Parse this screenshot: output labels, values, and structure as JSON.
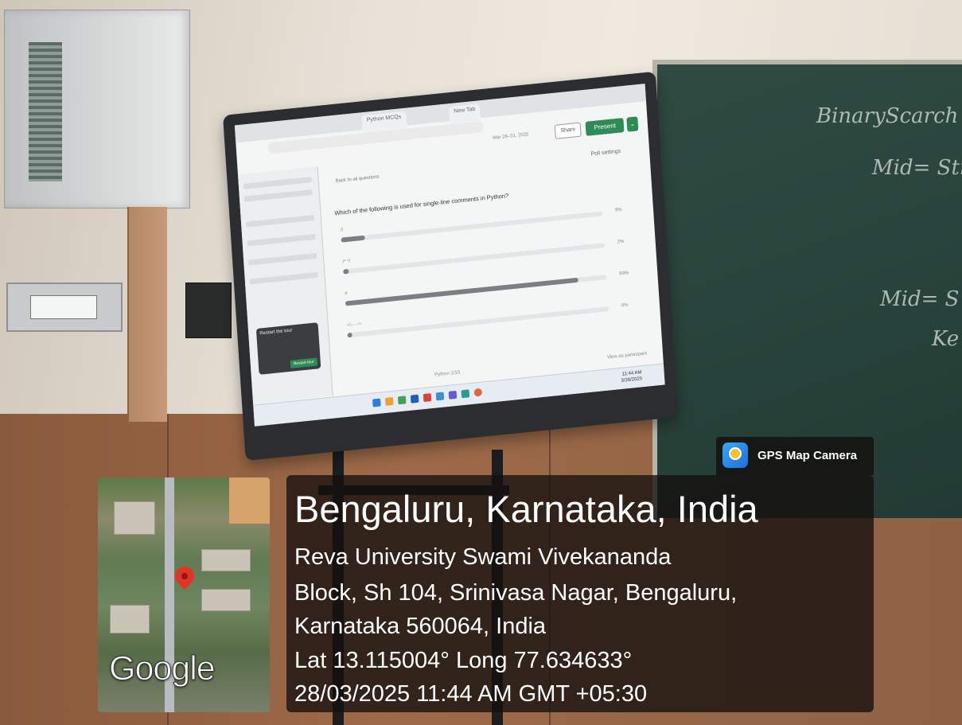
{
  "badge": {
    "label": "GPS Map Camera",
    "icon": "map-pin-camera-icon"
  },
  "location": {
    "title": "Bengaluru, Karnataka, India",
    "address_line1": "Reva University Swami Vivekananda",
    "address_line2": "Block, Sh 104, Srinivasa Nagar, Bengaluru,",
    "address_line3": "Karnataka 560064, India",
    "coordinates": "Lat 13.115004° Long 77.634633°",
    "timestamp": "28/03/2025 11:44 AM GMT +05:30"
  },
  "map": {
    "logo_text": "Google",
    "pin_icon": "location-pin-icon"
  },
  "chalkboard": {
    "line1": "BinaryScarch",
    "line2": "Mid= Stri",
    "line3": "Mid= S",
    "line4": "Ke"
  },
  "screen": {
    "tabs": [
      "Python MCQs",
      "New Tab"
    ],
    "date_range": "Mar 28–31, 2025",
    "share_label": "Share",
    "present_label": "Present",
    "present_more": "⌄",
    "back_label": "Back to all questions",
    "poll_settings_label": "Poll settings",
    "question": "Which of the following is used for single-line comments in Python?",
    "options": [
      {
        "label": "//",
        "percent_value": 9,
        "percent_text": "9%"
      },
      {
        "label": "/* */",
        "percent_value": 2,
        "percent_text": "2%"
      },
      {
        "label": "#",
        "percent_value": 89,
        "percent_text": "89%"
      },
      {
        "label": "<!-- -->",
        "percent_value": 0,
        "percent_text": "0%"
      }
    ],
    "footer_center": "Python 1/10",
    "footer_right": "View as participant",
    "tour_title": "Restart the tour",
    "tour_button": "Restart tour",
    "clock_time": "11:44 AM",
    "clock_date": "3/28/2025",
    "accent_color": "#2e8b57"
  }
}
